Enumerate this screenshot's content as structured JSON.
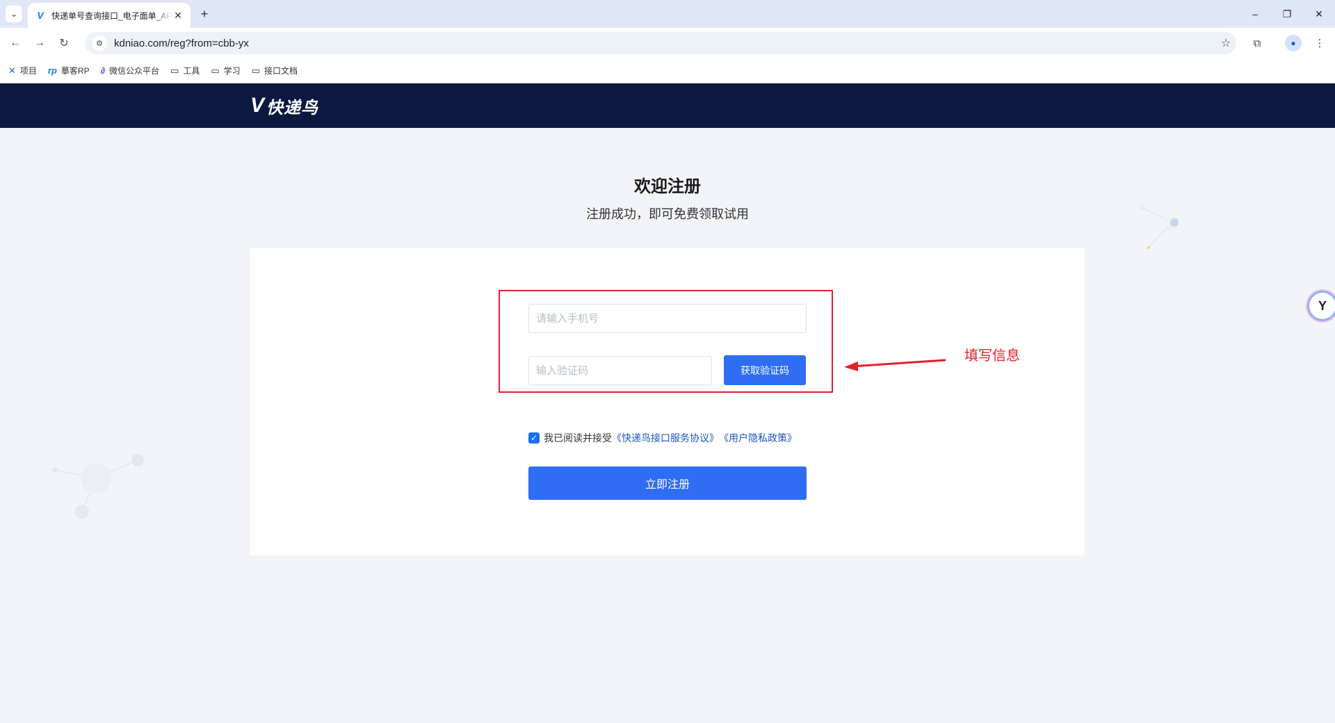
{
  "browser": {
    "tab": {
      "title": "快递单号查询接口_电子面单_API",
      "favicon": "V",
      "close_glyph": "✕"
    },
    "new_tab_glyph": "+",
    "url": "kdniao.com/reg?from=cbb-yx",
    "window_controls": [
      "–",
      "❐",
      "✕"
    ]
  },
  "bookmarks": [
    {
      "icon": "x-logo-icon",
      "label": "项目"
    },
    {
      "icon": "rp-logo-icon",
      "label": "摹客RP"
    },
    {
      "icon": "link-icon",
      "label": "微信公众平台"
    },
    {
      "icon": "folder-icon",
      "label": "工具"
    },
    {
      "icon": "folder-icon",
      "label": "学习"
    },
    {
      "icon": "folder-icon",
      "label": "接口文档"
    }
  ],
  "site": {
    "logo_text": "快递鸟",
    "logo_mark": "V"
  },
  "page": {
    "title": "欢迎注册",
    "subtitle": "注册成功，即可免费领取试用"
  },
  "form": {
    "phone_placeholder": "请输入手机号",
    "code_placeholder": "输入验证码",
    "get_code_label": "获取验证码",
    "agree_prefix": "我已阅读并接受",
    "agree_link_service": "《快递鸟接口服务协议》",
    "agree_link_privacy": "《用户隐私政策》",
    "agree_checked": true,
    "submit_label": "立即注册"
  },
  "annotation": {
    "text": "填写信息",
    "color": "#e0212b"
  },
  "colors": {
    "header_bg": "#0b1940",
    "primary": "#2f6ef2",
    "page_bg": "#f3f4f8"
  }
}
